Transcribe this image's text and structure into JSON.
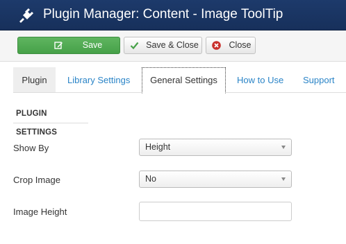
{
  "header": {
    "title": "Plugin Manager: Content - Image ToolTip",
    "icon": "plug-icon"
  },
  "toolbar": {
    "save_label": "Save",
    "save_close_label": "Save & Close",
    "close_label": "Close",
    "save_color": "#51a351"
  },
  "tabs": [
    {
      "label": "Plugin"
    },
    {
      "label": "Library Settings"
    },
    {
      "label": "General Settings"
    },
    {
      "label": "How to Use"
    },
    {
      "label": "Support"
    }
  ],
  "active_tab": "General Settings",
  "section": {
    "title": "PLUGIN SETTINGS"
  },
  "fields": {
    "show_by": {
      "label": "Show By",
      "value": "Height"
    },
    "crop_image": {
      "label": "Crop Image",
      "value": "No"
    },
    "image_height": {
      "label": "Image Height",
      "value": ""
    }
  }
}
